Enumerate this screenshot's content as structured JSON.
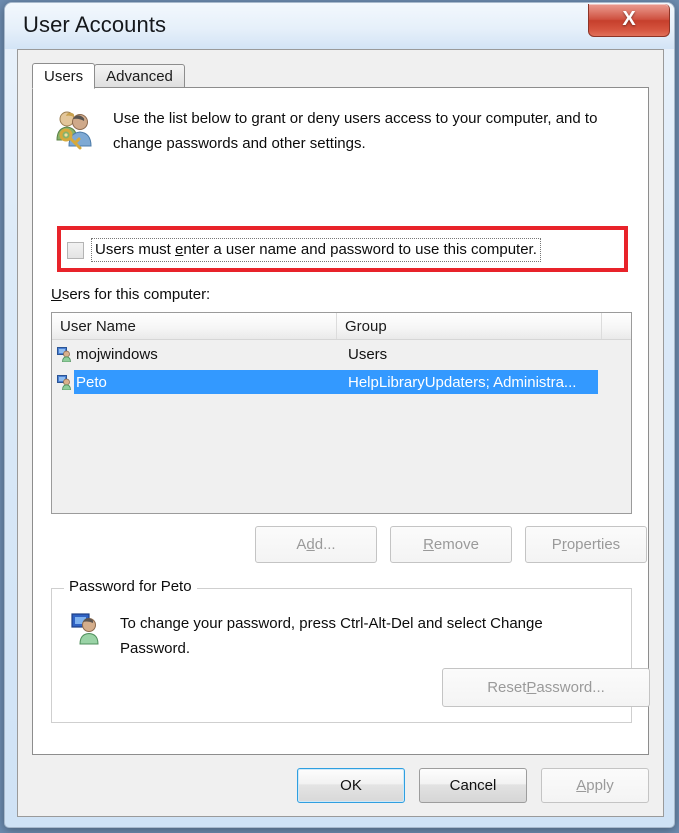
{
  "window": {
    "title": "User Accounts",
    "close_icon": "close-x-icon",
    "close_label": "X"
  },
  "tabs": [
    {
      "label": "Users",
      "active": true
    },
    {
      "label": "Advanced",
      "active": false
    }
  ],
  "intro": {
    "icon": "users-with-key-icon",
    "text": "Use the list below to grant or deny users access to your computer, and to change passwords and other settings."
  },
  "require_password_checkbox": {
    "label_before": "Users must ",
    "accel": "e",
    "label_after": "nter a user name and password to use this computer.",
    "checked": false,
    "focused": true,
    "highlight_color": "#e8232a"
  },
  "list": {
    "caption_accel": "U",
    "caption_rest": "sers for this computer:",
    "columns": [
      "User Name",
      "Group",
      ""
    ],
    "rows": [
      {
        "icon": "user-account-icon",
        "username": "mojwindows",
        "group": "Users",
        "selected": false
      },
      {
        "icon": "user-account-icon",
        "username": "Peto",
        "group": "HelpLibraryUpdaters; Administra...",
        "selected": true
      }
    ],
    "selection_color": "#3399ff"
  },
  "list_buttons": [
    {
      "name": "add-button",
      "before": "A",
      "accel": "d",
      "after": "d...",
      "disabled": true
    },
    {
      "name": "remove-button",
      "before": "",
      "accel": "R",
      "after": "emove",
      "disabled": true
    },
    {
      "name": "properties-button",
      "before": "P",
      "accel": "r",
      "after": "operties",
      "disabled": true
    }
  ],
  "password_group": {
    "legend": "Password for Peto",
    "icon": "single-user-icon",
    "text": "To change your password, press Ctrl-Alt-Del and select Change Password.",
    "reset_button": {
      "before": "Reset ",
      "accel": "P",
      "after": "assword...",
      "disabled": true
    }
  },
  "footer_buttons": [
    {
      "name": "ok-button",
      "label": "OK",
      "style": "default"
    },
    {
      "name": "cancel-button",
      "label": "Cancel",
      "style": "normal"
    },
    {
      "name": "apply-button",
      "before": "",
      "accel": "A",
      "after": "pply",
      "style": "disabled"
    }
  ]
}
